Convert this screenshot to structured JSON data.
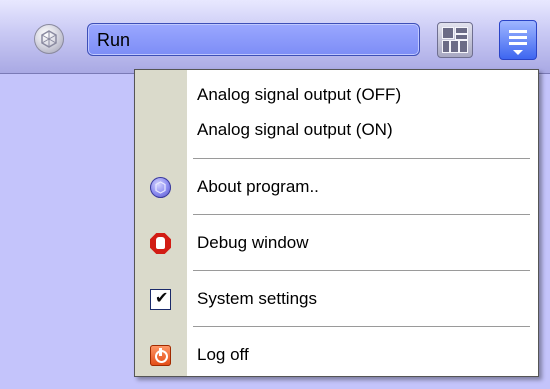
{
  "toolbar": {
    "status_text": "Run",
    "app_icon": "aperture-icon",
    "layout_icon": "grid-layout-icon",
    "menu_icon": "menu-icon"
  },
  "menu": {
    "items": [
      {
        "label": "Analog signal output (OFF)",
        "icon": null
      },
      {
        "label": "Analog signal output (ON)",
        "icon": null
      },
      {
        "label": "About program..",
        "icon": "about-icon"
      },
      {
        "label": "Debug window",
        "icon": "debug-icon"
      },
      {
        "label": "System settings",
        "icon": "checkbox-checked-icon"
      },
      {
        "label": "Log off",
        "icon": "log-off-icon"
      }
    ]
  },
  "colors": {
    "background": "#c4c4fb",
    "status_field": "#8a98fb",
    "menu_gutter": "#dadacb",
    "debug_icon": "#d21c14",
    "log_off_icon": "#e24a14"
  }
}
